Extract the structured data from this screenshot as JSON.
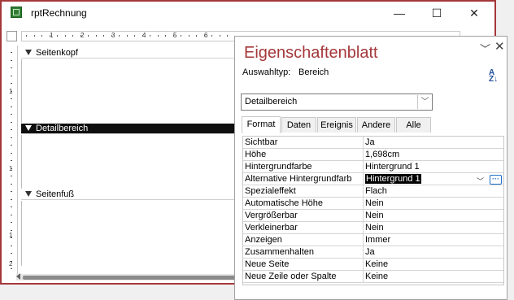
{
  "window": {
    "title": "rptRechnung",
    "minimize_glyph": "—",
    "maximize_glyph": "☐",
    "close_glyph": "✕"
  },
  "ruler": {
    "h_numbers": [
      "1",
      "2",
      "3",
      "4",
      "5",
      "6"
    ],
    "v_marks": [
      "1",
      "1",
      "1",
      "2"
    ]
  },
  "sections": [
    {
      "label": "Seitenkopf"
    },
    {
      "label": "Detailbereich"
    },
    {
      "label": "Seitenfuß"
    }
  ],
  "property_sheet": {
    "title": "Eigenschaftenblatt",
    "selection_type_label": "Auswahltyp:",
    "selection_type_value": "Bereich",
    "selected_object": "Detailbereich",
    "tabs": [
      "Format",
      "Daten",
      "Ereignis",
      "Andere",
      "Alle"
    ],
    "active_tab": "Format",
    "properties": [
      {
        "name": "Sichtbar",
        "value": "Ja"
      },
      {
        "name": "Höhe",
        "value": "1,698cm"
      },
      {
        "name": "Hintergrundfarbe",
        "value": "Hintergrund 1"
      },
      {
        "name": "Alternative Hintergrundfarb",
        "value": "Hintergrund 1"
      },
      {
        "name": "Spezialeffekt",
        "value": "Flach"
      },
      {
        "name": "Automatische Höhe",
        "value": "Nein"
      },
      {
        "name": "Vergrößerbar",
        "value": "Nein"
      },
      {
        "name": "Verkleinerbar",
        "value": "Nein"
      },
      {
        "name": "Anzeigen",
        "value": "Immer"
      },
      {
        "name": "Zusammenhalten",
        "value": "Ja"
      },
      {
        "name": "Neue Seite",
        "value": "Keine"
      },
      {
        "name": "Neue Zeile oder Spalte",
        "value": "Keine"
      }
    ],
    "selected_row": "Alternative Hintergrundfarb",
    "sort_icon": "sort-az-icon",
    "build_icon": "ellipsis-build-icon"
  },
  "colors": {
    "accent": "#a4373a",
    "selected_section": "#0f0f0f",
    "link_blue": "#1f6fc5"
  }
}
